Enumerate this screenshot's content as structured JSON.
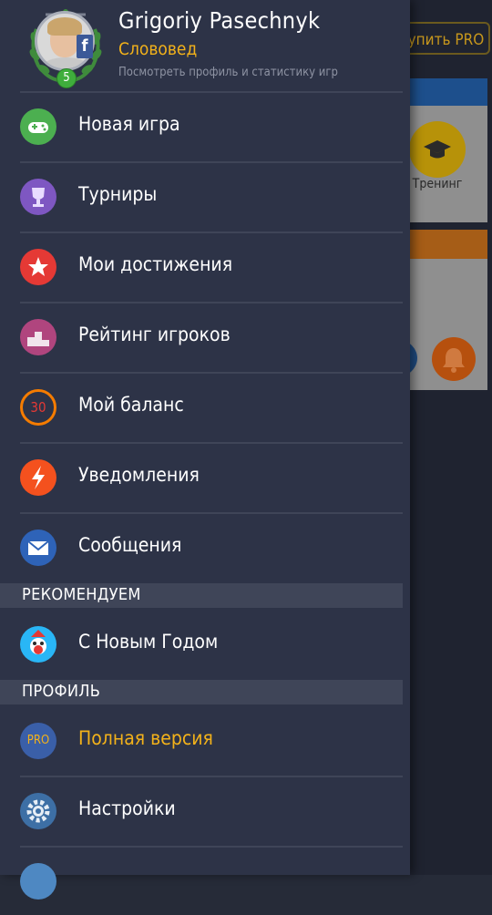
{
  "background": {
    "buy_pro": "Купить PRO",
    "training_label": "Тренинг"
  },
  "profile": {
    "name": "Grigoriy Pasechnyk",
    "rank": "Слововед",
    "link": "Посмотреть профиль и статистику игр",
    "level": "5",
    "social_badge": "f"
  },
  "menu": [
    {
      "label": "Новая игра",
      "icon": "gamepad-icon",
      "color": "#4caf50"
    },
    {
      "label": "Турниры",
      "icon": "trophy-icon",
      "color": "#7e57c2"
    },
    {
      "label": "Мои достижения",
      "icon": "star-icon",
      "color": "#e53935"
    },
    {
      "label": "Рейтинг игроков",
      "icon": "podium-icon",
      "color": "#b0457e"
    },
    {
      "label": "Мой баланс",
      "icon": "balance-icon",
      "color": "#f57c00",
      "value": "30"
    },
    {
      "label": "Уведомления",
      "icon": "lightning-icon",
      "color": "#f4511e"
    },
    {
      "label": "Сообщения",
      "icon": "envelope-icon",
      "color": "#2e63b8"
    }
  ],
  "section_recommend": {
    "title": "РЕКОМЕНДУЕМ",
    "items": [
      {
        "label": "С Новым Годом",
        "icon": "new-year-icon",
        "color": "#29b6f6"
      }
    ]
  },
  "section_profile": {
    "title": "ПРОФИЛЬ",
    "items": [
      {
        "label": "Полная версия",
        "icon": "pro-icon",
        "color": "#3a5fa8",
        "badge": "PRO"
      },
      {
        "label": "Настройки",
        "icon": "settings-gear-icon",
        "color": "#3d6fa5"
      }
    ]
  }
}
